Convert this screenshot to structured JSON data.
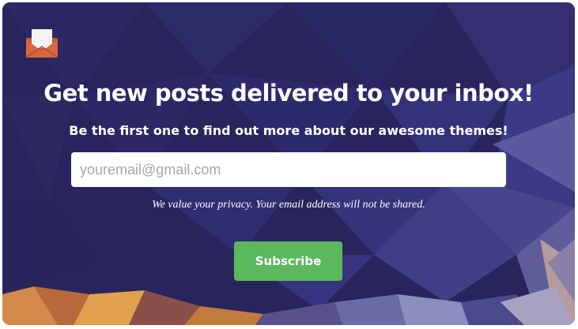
{
  "newsletter": {
    "headline": "Get new posts delivered to your inbox!",
    "subheadline": "Be the first one to find out more about our awesome themes!",
    "email_placeholder": "youremail@gmail.com",
    "privacy_note": "We value your privacy. Your email address will not be shared.",
    "subscribe_label": "Subscribe",
    "icon": "envelope-icon"
  },
  "colors": {
    "background": "#2a2760",
    "button": "#5cb85c",
    "text": "#ffffff",
    "envelope": "#c8593c"
  }
}
